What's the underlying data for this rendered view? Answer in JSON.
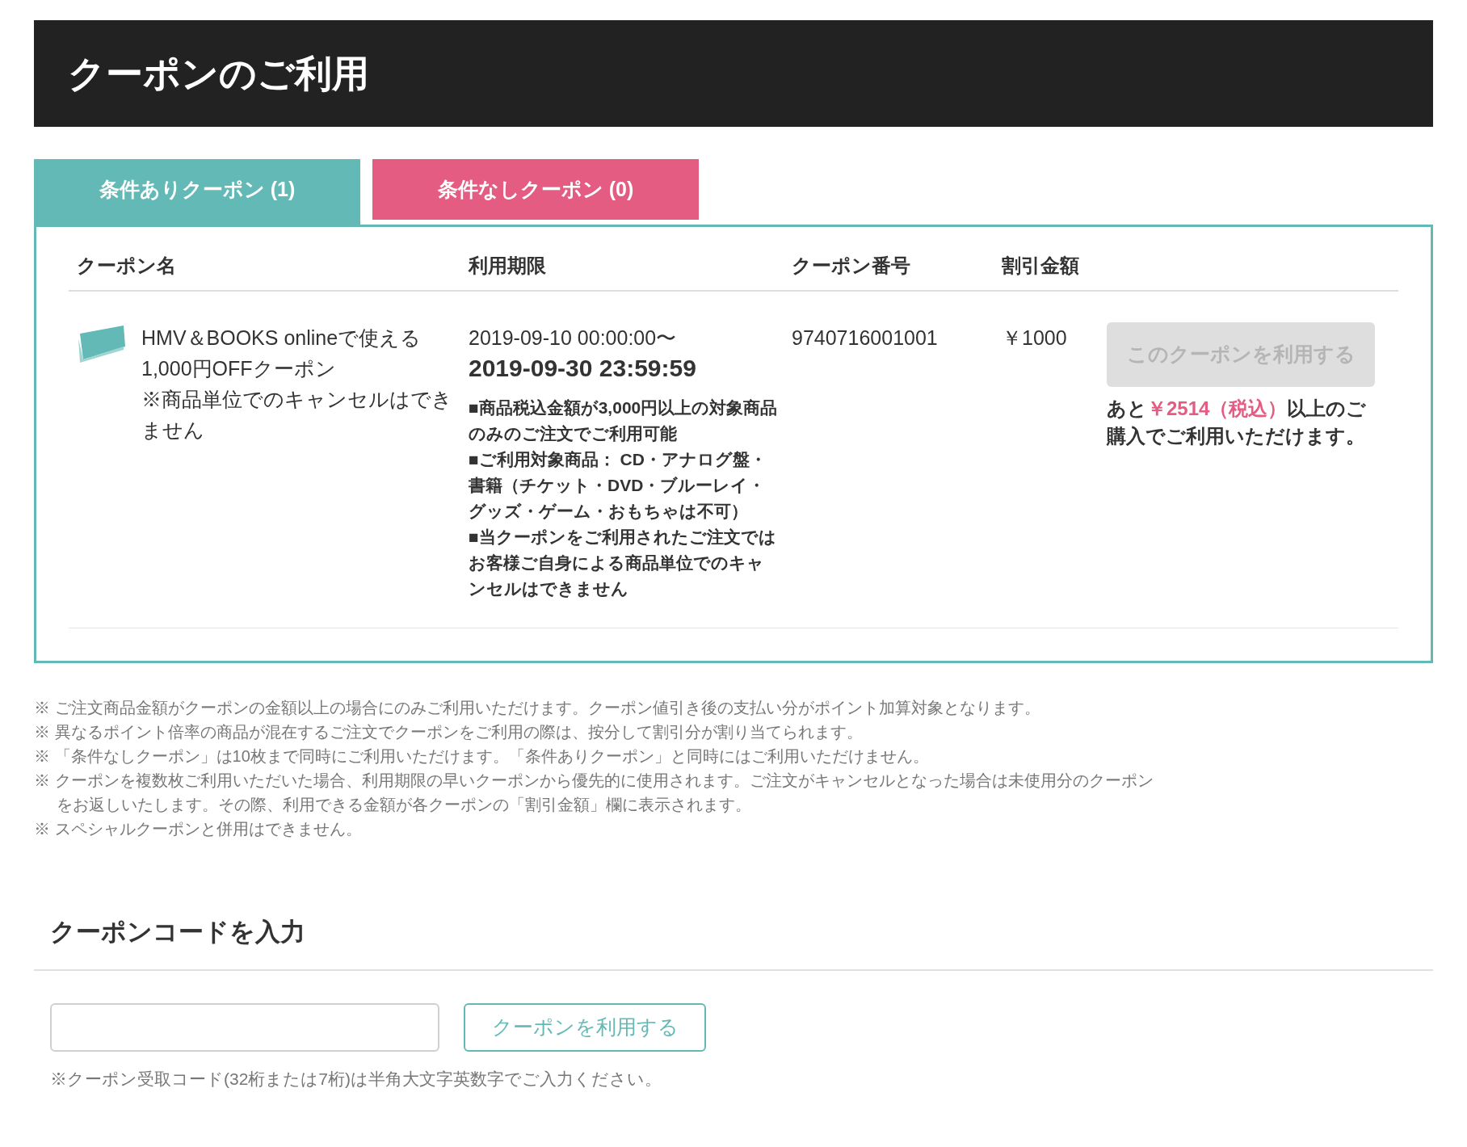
{
  "page_title": "クーポンのご利用",
  "tabs": [
    {
      "label": "条件ありクーポン (1)",
      "selected": true,
      "color": "#63b9b5"
    },
    {
      "label": "条件なしクーポン (0)",
      "selected": false,
      "color": "#e45c82"
    }
  ],
  "table": {
    "columns": [
      "クーポン名",
      "利用期限",
      "クーポン番号",
      "割引金額"
    ],
    "rows": [
      {
        "name": "HMV＆BOOKS onlineで使える1,000円OFFクーポン",
        "name_note": "※商品単位でのキャンセルはできません",
        "valid_from": "2019-09-10 00:00:00〜",
        "valid_until": "2019-09-30 23:59:59",
        "conditions": [
          "■商品税込金額が3,000円以上の対象商品のみのご注文でご利用可能",
          "■ご利用対象商品： CD・アナログ盤・書籍（チケット・DVD・ブルーレイ・グッズ・ゲーム・おもちゃは不可）",
          "■当クーポンをご利用されたご注文ではお客様ご自身による商品単位でのキャンセルはできません"
        ],
        "number": "9740716001001",
        "discount": "￥1000",
        "button": {
          "label": "このクーポンを利用する",
          "disabled": true
        },
        "remaining": {
          "prefix": "あと",
          "amount": "￥2514（税込）",
          "suffix": "以上のご購入でご利用いただけます。"
        }
      }
    ]
  },
  "notes": [
    "※ ご注文商品金額がクーポンの金額以上の場合にのみご利用いただけます。クーポン値引き後の支払い分がポイント加算対象となります。",
    "※ 異なるポイント倍率の商品が混在するご注文でクーポンをご利用の際は、按分して割引分が割り当てられます。",
    "※ 「条件なしクーポン」は10枚まで同時にご利用いただけます。「条件ありクーポン」と同時にはご利用いただけません。",
    "※ クーポンを複数枚ご利用いただいた場合、利用期限の早いクーポンから優先的に使用されます。ご注文がキャンセルとなった場合は未使用分のクーポンをお返しいたします。その際、利用できる金額が各クーポンの「割引金額」欄に表示されます。",
    "※ スペシャルクーポンと併用はできません。"
  ],
  "code_entry": {
    "heading": "クーポンコードを入力",
    "button": "クーポンを利用する",
    "hint": "※クーポン受取コード(32桁または7桁)は半角大文字英数字でご入力ください。"
  }
}
